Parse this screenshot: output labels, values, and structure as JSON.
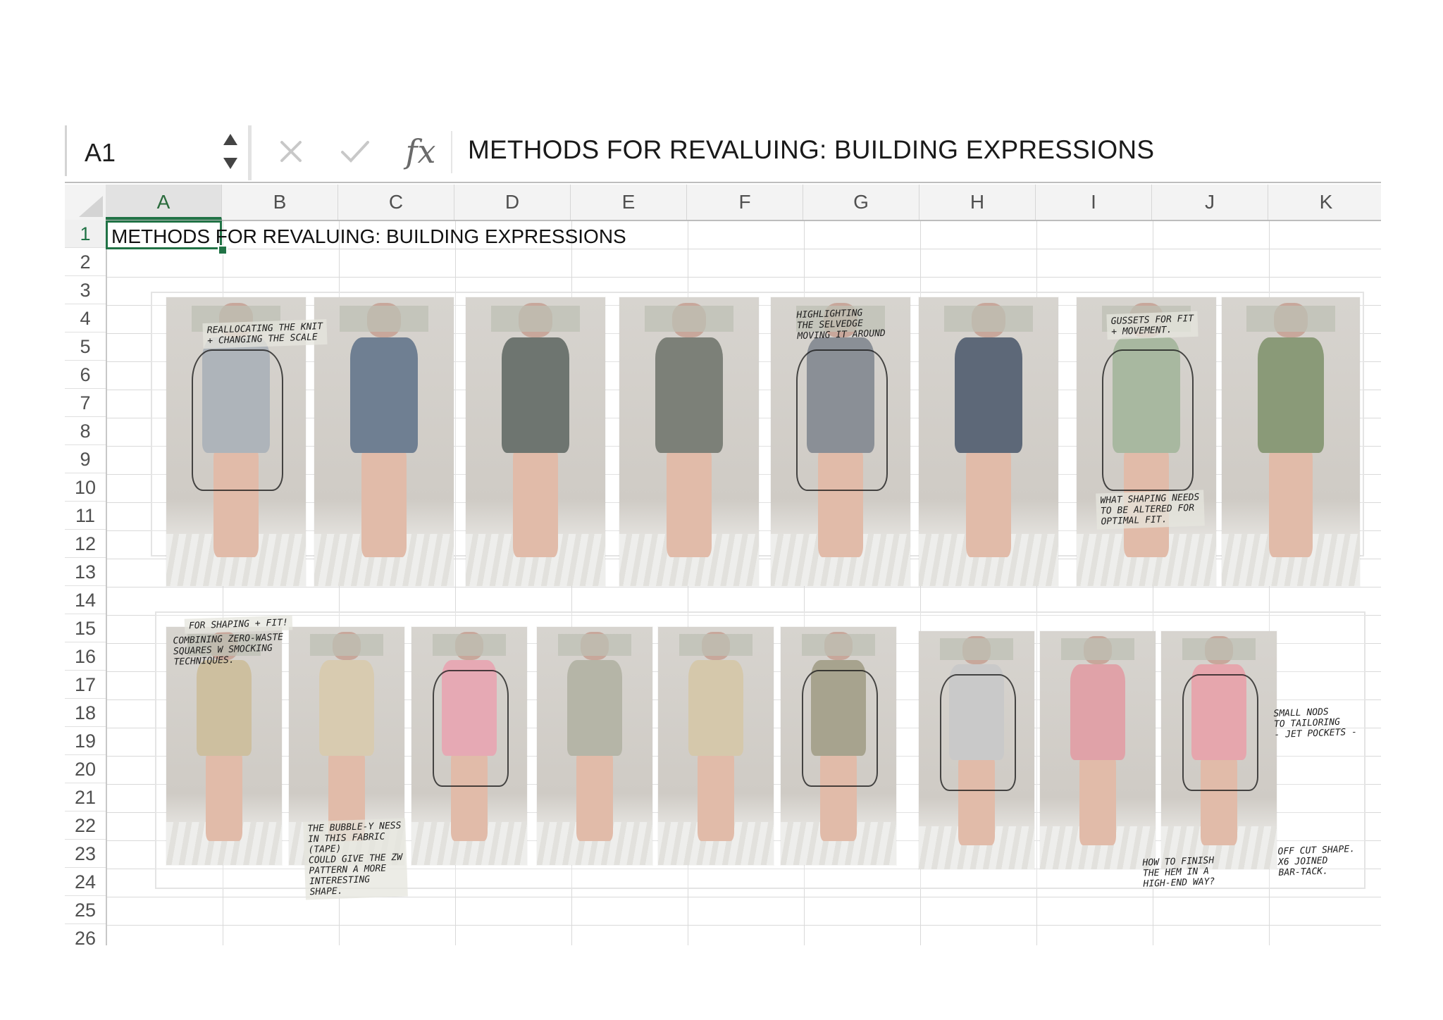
{
  "formula_bar": {
    "name_box": "A1",
    "fx_label": "fx",
    "formula": "METHODS FOR REVALUING: BUILDING EXPRESSIONS"
  },
  "grid": {
    "columns": [
      "A",
      "B",
      "C",
      "D",
      "E",
      "F",
      "G",
      "H",
      "I",
      "J",
      "K"
    ],
    "rows": [
      "1",
      "2",
      "3",
      "4",
      "5",
      "6",
      "7",
      "8",
      "9",
      "10",
      "11",
      "12",
      "13",
      "14",
      "15",
      "16",
      "17",
      "18",
      "19",
      "20",
      "21",
      "22",
      "23",
      "24",
      "25",
      "26"
    ],
    "selected_cell": "A1",
    "a1_value": "METHODS FOR REVALUING: BUILDING EXPRESSIONS"
  },
  "collage": {
    "top_row_notes": [
      "REALLOCATING THE KNIT\n+ CHANGING THE SCALE",
      "HIGHLIGHTING\nTHE SELVEDGE\nMOVING IT AROUND",
      "GUSSETS FOR FIT\n+ MOVEMENT.",
      "WHAT SHAPING NEEDS\nTO BE ALTERED FOR\nOPTIMAL FIT."
    ],
    "bottom_row_notes": [
      "FOR SHAPING + FIT!",
      "COMBINING ZERO-WASTE\nSQUARES W SMOCKING\nTECHNIQUES.",
      "THE BUBBLE-Y NESS\nIN THIS FABRIC\n(TAPE)\nCOULD GIVE THE ZW\nPATTERN A MORE\nINTERESTING\nSHAPE.",
      "SMALL NODS\nTO TAILORING\n- JET POCKETS -",
      "HOW TO FINISH\nTHE HEM IN A\nHIGH-END WAY?",
      "OFF CUT SHAPE.\nX6 JOINED\nBAR-TACK."
    ]
  },
  "colors": {
    "selection": "#217346",
    "gridline": "#d9d9d9",
    "header_bg": "#f3f3f3"
  }
}
